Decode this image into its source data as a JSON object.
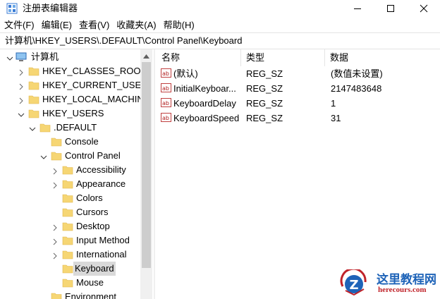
{
  "window": {
    "title": "注册表编辑器",
    "controls": {
      "minimize_icon": "minimize-icon",
      "maximize_icon": "maximize-icon",
      "close_icon": "close-icon"
    }
  },
  "menu": [
    {
      "label": "文件(F)"
    },
    {
      "label": "编辑(E)"
    },
    {
      "label": "查看(V)"
    },
    {
      "label": "收藏夹(A)"
    },
    {
      "label": "帮助(H)"
    }
  ],
  "address": "计算机\\HKEY_USERS\\.DEFAULT\\Control Panel\\Keyboard",
  "tree": {
    "root": "计算机",
    "hkcr": "HKEY_CLASSES_ROOT",
    "hkcu": "HKEY_CURRENT_USER",
    "hklm": "HKEY_LOCAL_MACHINE",
    "hku": "HKEY_USERS",
    "default": ".DEFAULT",
    "console": "Console",
    "control_panel": "Control Panel",
    "accessibility": "Accessibility",
    "appearance": "Appearance",
    "colors": "Colors",
    "cursors": "Cursors",
    "desktop": "Desktop",
    "input_method": "Input Method",
    "international": "International",
    "keyboard": "Keyboard",
    "mouse": "Mouse",
    "environment": "Environment"
  },
  "list": {
    "headers": {
      "name": "名称",
      "type": "类型",
      "data": "数据"
    },
    "rows": [
      {
        "name": "(默认)",
        "type": "REG_SZ",
        "data": "(数值未设置)"
      },
      {
        "name": "InitialKeyboar...",
        "type": "REG_SZ",
        "data": "2147483648"
      },
      {
        "name": "KeyboardDelay",
        "type": "REG_SZ",
        "data": "1"
      },
      {
        "name": "KeyboardSpeed",
        "type": "REG_SZ",
        "data": "31"
      }
    ]
  },
  "watermark": {
    "title": "这里教程网",
    "url": "herecours.com"
  },
  "colors": {
    "folder": "#f6d674",
    "selection": "#d9d9d9",
    "watermark_blue": "#1e63b8",
    "watermark_red": "#c0232a"
  }
}
